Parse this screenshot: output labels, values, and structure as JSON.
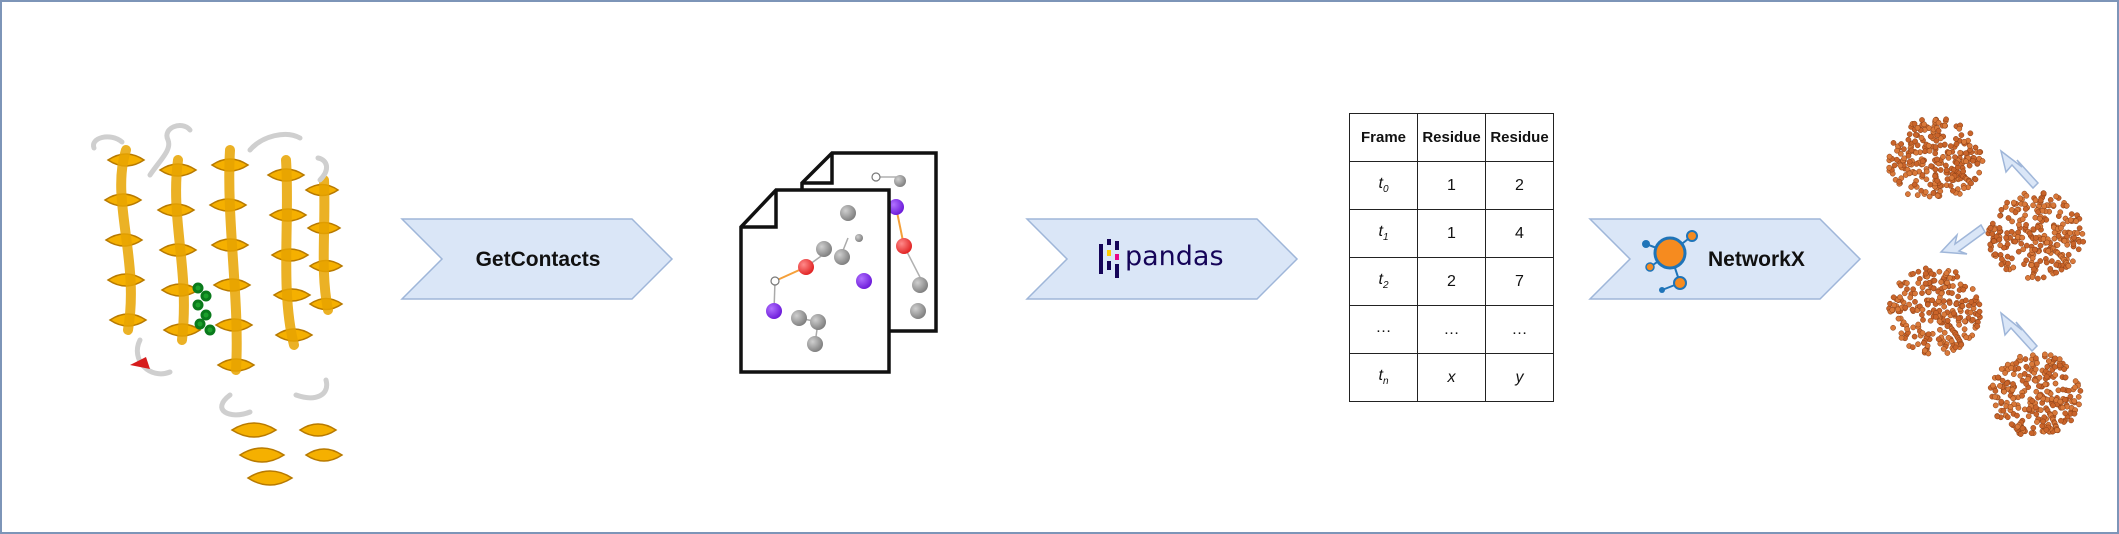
{
  "steps": {
    "getcontacts": {
      "label": "GetContacts"
    },
    "pandas": {
      "label": "pandas"
    },
    "networkx": {
      "label": "NetworkX"
    }
  },
  "table": {
    "headers": [
      "Frame",
      "Residue",
      "Residue"
    ],
    "rows": [
      {
        "frame": "t",
        "sub": "0",
        "a": "1",
        "b": "2"
      },
      {
        "frame": "t",
        "sub": "1",
        "a": "1",
        "b": "4"
      },
      {
        "frame": "t",
        "sub": "2",
        "a": "2",
        "b": "7"
      },
      {
        "frame": "…",
        "sub": "",
        "a": "…",
        "b": "…"
      },
      {
        "frame": "t",
        "sub": "n",
        "a": "x",
        "b": "y"
      }
    ]
  },
  "colors": {
    "frame_border": "#7d95b8",
    "chevron_fill": "#dae6f7",
    "chevron_stroke": "#9fb6d9",
    "protein": "#f2a900",
    "cluster": "#d9793a",
    "pandas_brand": "#150458",
    "networkx_orange": "#f68b1f",
    "networkx_blue": "#1f74b8"
  },
  "icons": [
    "protein-structure-icon",
    "contact-documents-icon",
    "pandas-logo-icon",
    "networkx-logo-icon",
    "cluster-graph-icon"
  ]
}
